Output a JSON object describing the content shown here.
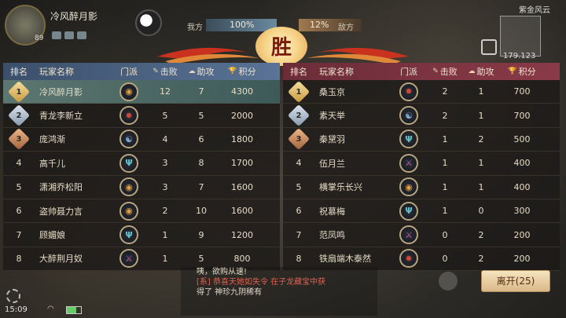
{
  "top": {
    "player_name": "冷风醉月影",
    "player_level": "89",
    "our_side_label": "我方",
    "our_pct": "100%",
    "enemy_pct": "12%",
    "enemy_side_label": "敌方",
    "zone_name": "紫金风云",
    "coords": "179.123"
  },
  "banner": {
    "result": "胜"
  },
  "table": {
    "headers": {
      "rank": "排名",
      "name": "玩家名称",
      "sect": "门派",
      "kills": "击败",
      "assists": "助攻",
      "score": "积分"
    },
    "left": [
      {
        "rank": "1",
        "name": "冷风醉月影",
        "sect": "sun",
        "kills": "12",
        "assists": "7",
        "score": "4300",
        "self": true
      },
      {
        "rank": "2",
        "name": "青龙李新立",
        "sect": "flame",
        "kills": "5",
        "assists": "5",
        "score": "2000"
      },
      {
        "rank": "3",
        "name": "庞鸿渐",
        "sect": "yinyang",
        "kills": "4",
        "assists": "6",
        "score": "1800"
      },
      {
        "rank": "4",
        "name": "高千儿",
        "sect": "trident",
        "kills": "3",
        "assists": "8",
        "score": "1700"
      },
      {
        "rank": "5",
        "name": "潇湘乔松阳",
        "sect": "sun",
        "kills": "3",
        "assists": "7",
        "score": "1600"
      },
      {
        "rank": "6",
        "name": "盗帅聂力言",
        "sect": "sun",
        "kills": "2",
        "assists": "10",
        "score": "1600"
      },
      {
        "rank": "7",
        "name": "顾媚娘",
        "sect": "trident",
        "kills": "1",
        "assists": "9",
        "score": "1200"
      },
      {
        "rank": "8",
        "name": "大醉荆月奴",
        "sect": "blade",
        "kills": "1",
        "assists": "5",
        "score": "800"
      }
    ],
    "right": [
      {
        "rank": "1",
        "name": "桑玉京",
        "sect": "flame",
        "kills": "2",
        "assists": "1",
        "score": "700"
      },
      {
        "rank": "2",
        "name": "素天举",
        "sect": "yinyang",
        "kills": "2",
        "assists": "1",
        "score": "700"
      },
      {
        "rank": "3",
        "name": "秦黛羽",
        "sect": "trident",
        "kills": "1",
        "assists": "2",
        "score": "500"
      },
      {
        "rank": "4",
        "name": "伍月兰",
        "sect": "blade",
        "kills": "1",
        "assists": "1",
        "score": "400"
      },
      {
        "rank": "5",
        "name": "横掌乐长兴",
        "sect": "sun",
        "kills": "1",
        "assists": "1",
        "score": "400"
      },
      {
        "rank": "6",
        "name": "祝慕梅",
        "sect": "trident",
        "kills": "1",
        "assists": "0",
        "score": "300"
      },
      {
        "rank": "7",
        "name": "范凤鸣",
        "sect": "blade",
        "kills": "0",
        "assists": "2",
        "score": "200"
      },
      {
        "rank": "8",
        "name": "铁扇端木泰然",
        "sect": "flame",
        "kills": "0",
        "assists": "2",
        "score": "200"
      }
    ]
  },
  "chat": {
    "line1": "咦，欲购从速!",
    "line2": "[系] 恭喜天她如失令 在子龙藏宝中获",
    "line3": "得了 神珍九阴稀有"
  },
  "leave_button": "离开(25)",
  "status": {
    "time": "15:09"
  },
  "colors": {
    "left_header": "#4a6385",
    "right_header": "#7a3442",
    "self_row": "#5c7770",
    "sect_sun": "#e0a040",
    "sect_flame": "#d04838",
    "sect_yinyang": "#7fb0d8",
    "sect_trident": "#60c0c8",
    "sect_blade": "#c060a0"
  }
}
